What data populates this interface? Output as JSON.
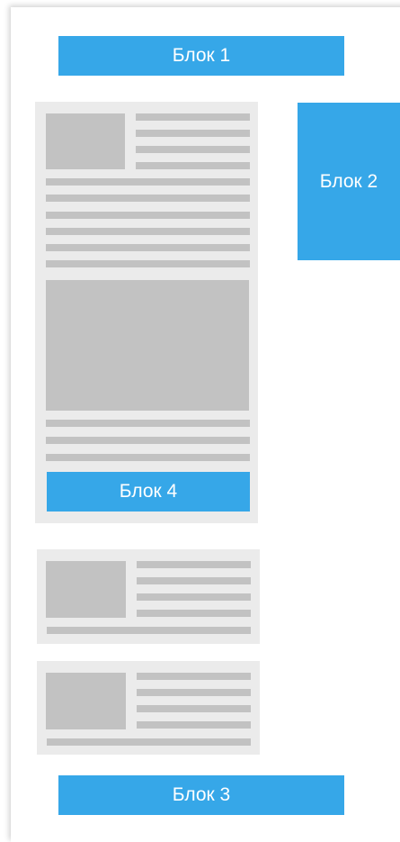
{
  "blocks": {
    "block1": "Блок 1",
    "block2": "Блок 2",
    "block3": "Блок 3",
    "block4": "Блок 4"
  },
  "colors": {
    "accent": "#36a7e8",
    "panel": "#ebebeb",
    "placeholder": "#c2c2c2"
  }
}
